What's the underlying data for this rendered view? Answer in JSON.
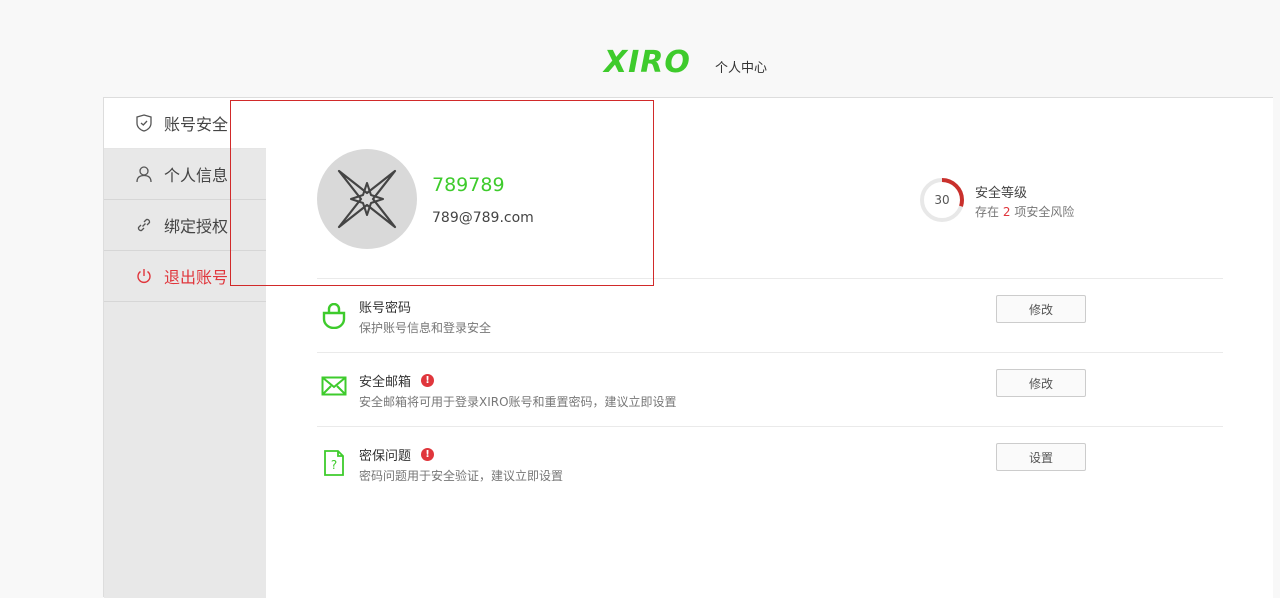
{
  "header": {
    "logo": "XIRO",
    "subtitle": "个人中心"
  },
  "sidebar": {
    "items": [
      {
        "label": "账号安全",
        "icon": "shield-icon",
        "active": true
      },
      {
        "label": "个人信息",
        "icon": "user-icon",
        "active": false
      },
      {
        "label": "绑定授权",
        "icon": "link-icon",
        "active": false
      },
      {
        "label": "退出账号",
        "icon": "power-icon",
        "active": false
      }
    ]
  },
  "profile": {
    "username": "789789",
    "email": "789@789.com",
    "avatar_icon": "xiro-star-icon"
  },
  "security_level": {
    "score": "30",
    "title": "安全等级",
    "desc_prefix": "存在",
    "risk_count": "2",
    "desc_suffix": "项安全风险",
    "progress": 0.3,
    "color": "#c9302c"
  },
  "rows": [
    {
      "title": "账号密码",
      "desc": "保护账号信息和登录安全",
      "button": "修改",
      "warning": false,
      "icon": "lock-icon"
    },
    {
      "title": "安全邮箱",
      "desc": "安全邮箱将可用于登录XIRO账号和重置密码，建议立即设置",
      "button": "修改",
      "warning": true,
      "icon": "mail-icon"
    },
    {
      "title": "密保问题",
      "desc": "密码问题用于安全验证，建议立即设置",
      "button": "设置",
      "warning": true,
      "icon": "question-doc-icon"
    }
  ],
  "colors": {
    "brand": "#3ecb2c",
    "danger": "#e0363c"
  }
}
